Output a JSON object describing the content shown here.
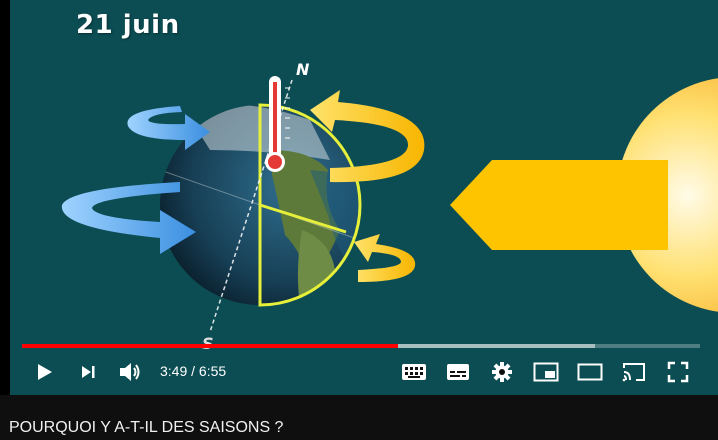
{
  "video": {
    "date_label": "21 juin",
    "north_label": "N",
    "south_label": "S",
    "colors": {
      "background": "#0b4d53",
      "arrow_yellow": "#ffc107",
      "arrow_blue": "#4aa3e8",
      "sun": "#ffd54a"
    }
  },
  "player": {
    "current_time": "3:49",
    "separator": " / ",
    "duration": "6:55",
    "progress": {
      "played_fraction": 0.555,
      "buffered_fraction": 0.845,
      "played_color": "#ff0000"
    },
    "controls": {
      "play": "play-icon",
      "next": "next-icon",
      "volume": "volume-icon",
      "keyboard": "keyboard-icon",
      "subtitles": "subtitles-icon",
      "settings": "gear-icon",
      "miniplayer": "miniplayer-icon",
      "theater": "theater-icon",
      "cast": "cast-icon",
      "fullscreen": "fullscreen-icon"
    }
  },
  "video_title": "POURQUOI Y A-T-IL DES SAISONS ?"
}
